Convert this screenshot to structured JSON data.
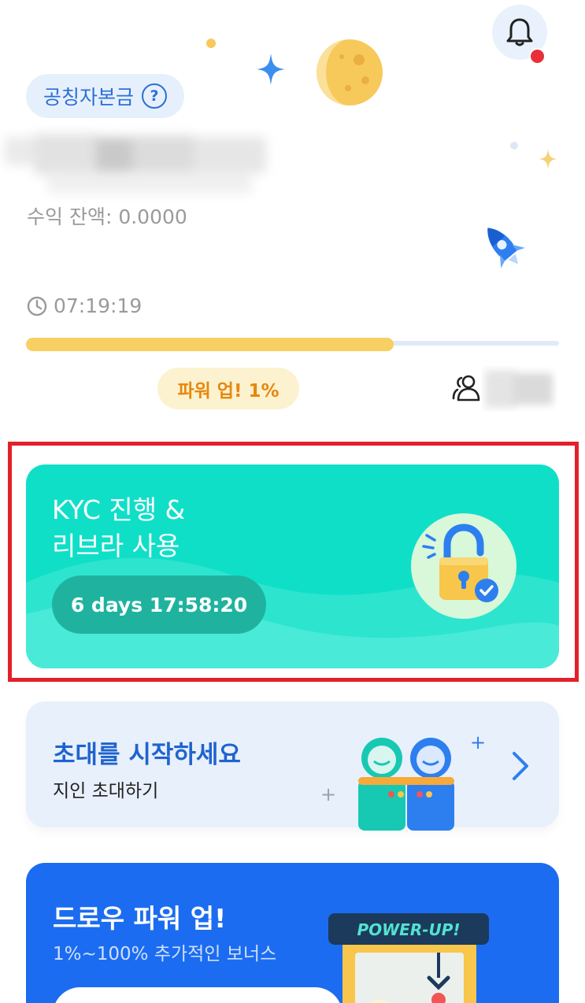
{
  "header": {
    "balance_label": "공칭자본금",
    "help_glyph": "?",
    "earned_balance": "수익 잔액: 0.0000",
    "session_timer": "07:19:19",
    "mining_progress_fraction": 0.69,
    "power_badge": "파워 업! 1%"
  },
  "kyc_card": {
    "title": "KYC 진행 &\n리브라 사용",
    "countdown": "6 days 17:58:20"
  },
  "invite_card": {
    "title": "초대를 시작하세요",
    "subtitle": "지인 초대하기"
  },
  "power_card": {
    "title": "드로우 파워 업!",
    "subtitle": "1%~100% 추가적인 보너스",
    "machine_sign": "POWER-UP!"
  },
  "icons": {
    "bell": "bell-icon",
    "help": "question-circle-icon",
    "clock": "clock-icon",
    "people": "people-icon",
    "lock": "padlock-icon",
    "chevron": "chevron-right-icon"
  },
  "colors": {
    "accent_blue": "#2b6fd6",
    "progress_yellow": "#f8cf62",
    "kyc_teal": "#10dfc8",
    "power_blue": "#1b6cf0",
    "alert_red": "#e8303a"
  }
}
